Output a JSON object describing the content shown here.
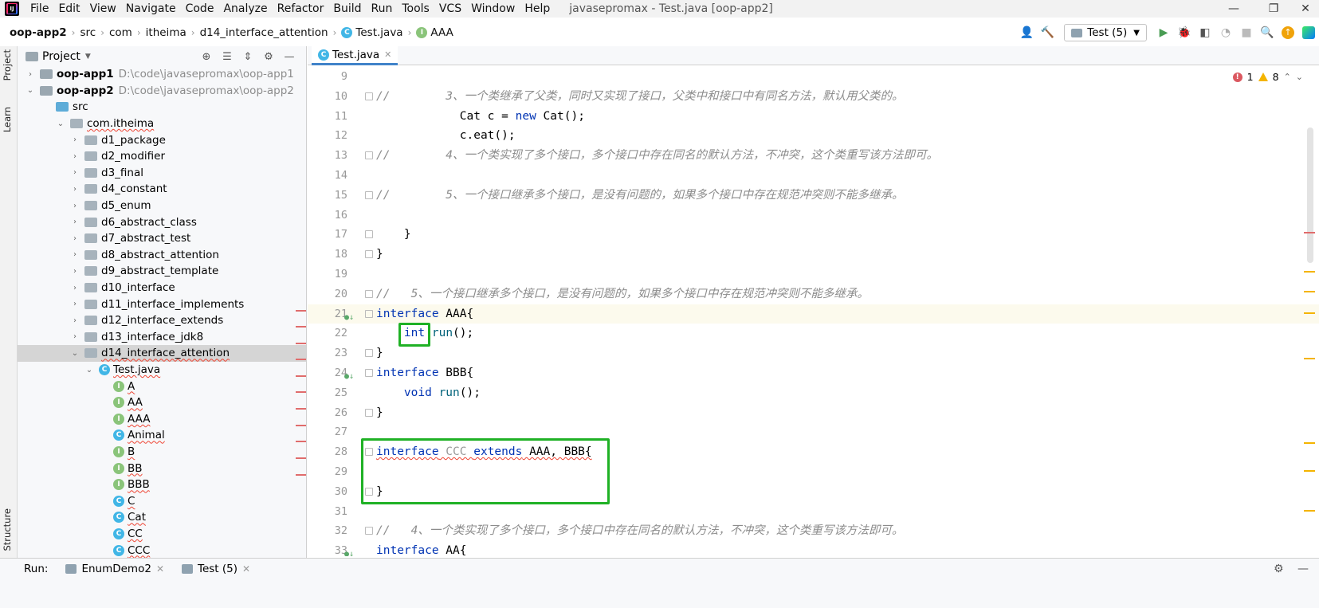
{
  "menubar": {
    "items": [
      "File",
      "Edit",
      "View",
      "Navigate",
      "Code",
      "Analyze",
      "Refactor",
      "Build",
      "Run",
      "Tools",
      "VCS",
      "Window",
      "Help"
    ],
    "title": "javasepromax - Test.java [oop-app2]"
  },
  "breadcrumb": {
    "items": [
      "oop-app2",
      "src",
      "com",
      "itheima",
      "d14_interface_attention",
      "Test.java",
      "AAA"
    ]
  },
  "toolbar": {
    "run_config": "Test (5)"
  },
  "side_tabs": {
    "project": "Project",
    "learn": "Learn",
    "structure": "Structure"
  },
  "project": {
    "header": "Project",
    "rows": [
      {
        "name": "oop-app1",
        "path": "D:\\code\\javasepromax\\oop-app1"
      },
      {
        "name": "oop-app2",
        "path": "D:\\code\\javasepromax\\oop-app2"
      },
      {
        "name": "src"
      },
      {
        "name": "com.itheima"
      },
      {
        "name": "d1_package"
      },
      {
        "name": "d2_modifier"
      },
      {
        "name": "d3_final"
      },
      {
        "name": "d4_constant"
      },
      {
        "name": "d5_enum"
      },
      {
        "name": "d6_abstract_class"
      },
      {
        "name": "d7_abstract_test"
      },
      {
        "name": "d8_abstract_attention"
      },
      {
        "name": "d9_abstract_template"
      },
      {
        "name": "d10_interface"
      },
      {
        "name": "d11_interface_implements"
      },
      {
        "name": "d12_interface_extends"
      },
      {
        "name": "d13_interface_jdk8"
      },
      {
        "name": "d14_interface_attention"
      },
      {
        "name": "Test.java"
      },
      {
        "name": "A"
      },
      {
        "name": "AA"
      },
      {
        "name": "AAA"
      },
      {
        "name": "Animal"
      },
      {
        "name": "B"
      },
      {
        "name": "BB"
      },
      {
        "name": "BBB"
      },
      {
        "name": "C"
      },
      {
        "name": "Cat"
      },
      {
        "name": "CC"
      },
      {
        "name": "CCC"
      }
    ]
  },
  "editor": {
    "tab": "Test.java",
    "errors": "1",
    "warnings": "8",
    "lines": [
      {
        "n": "9"
      },
      {
        "n": "10",
        "c": "//        3、一个类继承了父类，同时又实现了接口，父类中和接口中有同名方法，默认用父类的。"
      },
      {
        "n": "11",
        "a": "            Cat c = ",
        "b": "new",
        "d": " Cat();"
      },
      {
        "n": "12",
        "a": "            c.eat();"
      },
      {
        "n": "13",
        "c": "//        4、一个类实现了多个接口，多个接口中存在同名的默认方法，不冲突，这个类重写该方法即可。"
      },
      {
        "n": "14"
      },
      {
        "n": "15",
        "c": "//        5、一个接口继承多个接口，是没有问题的，如果多个接口中存在规范冲突则不能多继承。"
      },
      {
        "n": "16"
      },
      {
        "n": "17",
        "a": "    }"
      },
      {
        "n": "18",
        "a": "}"
      },
      {
        "n": "19"
      },
      {
        "n": "20",
        "c": "//   5、一个接口继承多个接口，是没有问题的，如果多个接口中存在规范冲突则不能多继承。"
      },
      {
        "n": "21",
        "b": "interface",
        "d": " AAA{"
      },
      {
        "n": "22",
        "a": "    ",
        "b": "int",
        "f": " run",
        "d": "();"
      },
      {
        "n": "23",
        "a": "}"
      },
      {
        "n": "24",
        "b": "interface",
        "d": " BBB{"
      },
      {
        "n": "25",
        "a": "    ",
        "b": "void",
        "f": " run",
        "d": "();"
      },
      {
        "n": "26",
        "a": "}"
      },
      {
        "n": "27"
      },
      {
        "n": "28",
        "b": "interface",
        "g": " CCC ",
        "b2": "extends",
        "d": " AAA, BBB{"
      },
      {
        "n": "29"
      },
      {
        "n": "30",
        "a": "}"
      },
      {
        "n": "31"
      },
      {
        "n": "32",
        "c": "//   4、一个类实现了多个接口，多个接口中存在同名的默认方法，不冲突，这个类重写该方法即可。"
      },
      {
        "n": "33",
        "b": "interface",
        "d": " AA{"
      }
    ]
  },
  "runbar": {
    "label": "Run:",
    "tabs": [
      "EnumDemo2",
      "Test (5)"
    ]
  },
  "colors": {
    "highlight_box": "#1fb125",
    "keyword": "#0033b3",
    "comment": "#8c8c8c"
  }
}
